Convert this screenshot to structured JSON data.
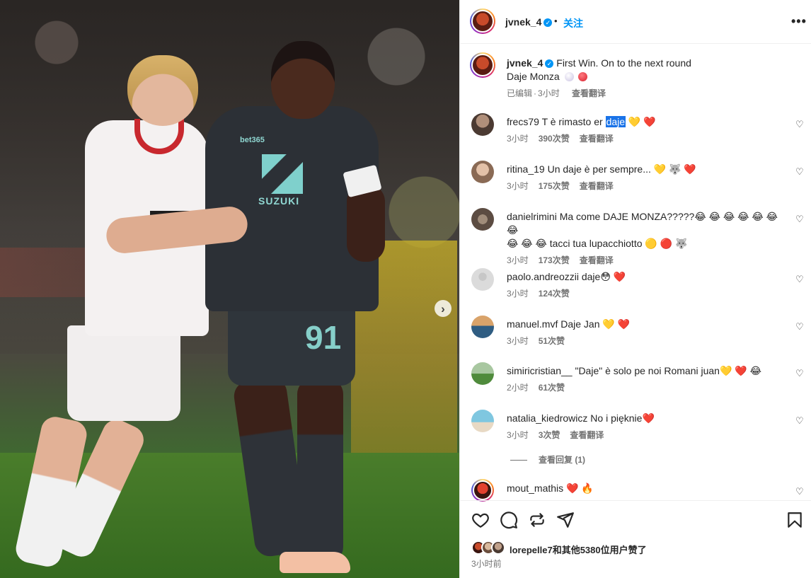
{
  "post": {
    "author": "jvnek_4",
    "follow_label": "关注",
    "more_label": "•••",
    "caption_line1": "First Win. On to the next round",
    "caption_line2": "Daje Monza",
    "caption_meta_edited": "已编辑",
    "caption_meta_time": "3小时",
    "see_translation": "查看翻译"
  },
  "media": {
    "jersey_number": "91",
    "sponsor_suzuki": "SUZUKI",
    "sponsor_bet": "bet365"
  },
  "comments": [
    {
      "user": "frecs79",
      "text_before": "T è rimasto er ",
      "highlight": "daje",
      "text_after": " 💛 ❤️",
      "time": "3小时",
      "likes": "390次赞",
      "translate": "查看翻译"
    },
    {
      "user": "ritina_19",
      "text": "Un daje è per sempre... 💛 🐺 ❤️",
      "time": "3小时",
      "likes": "175次赞",
      "translate": "查看翻译"
    },
    {
      "user": "danielrimini",
      "text": "Ma come DAJE MONZA?????😂 😂 😂 😂 😂 😂 😂",
      "text2": "😂 😂 😂  tacci tua lupacchiotto 🟡 🔴 🐺",
      "time": "3小时",
      "likes": "173次赞",
      "translate": "查看翻译"
    },
    {
      "user": "paolo.andreozzii",
      "text": "daje😳 ❤️",
      "time": "3小时",
      "likes": "124次赞"
    },
    {
      "user": "manuel.mvf",
      "text": "Daje Jan  💛 ❤️",
      "time": "3小时",
      "likes": "51次赞"
    },
    {
      "user": "simiricristian__",
      "text": "\"Daje\" è solo pe noi Romani juan💛 ❤️ 😂",
      "time": "2小时",
      "likes": "61次赞"
    },
    {
      "user": "natalia_kiedrowicz",
      "text": "No i pięknie❤️",
      "time": "3小时",
      "likes": "3次赞",
      "translate": "查看翻译"
    },
    {
      "user": "mout_mathis",
      "text": "❤️ 🔥"
    }
  ],
  "view_replies": "查看回复 (1)",
  "liked_by": {
    "text": "lorepelle7和其他5380位用户赞了"
  },
  "post_time": "3小时前",
  "colors": {
    "accent": "#0095f6",
    "like_red": "#ed4956",
    "muted": "#737373"
  }
}
